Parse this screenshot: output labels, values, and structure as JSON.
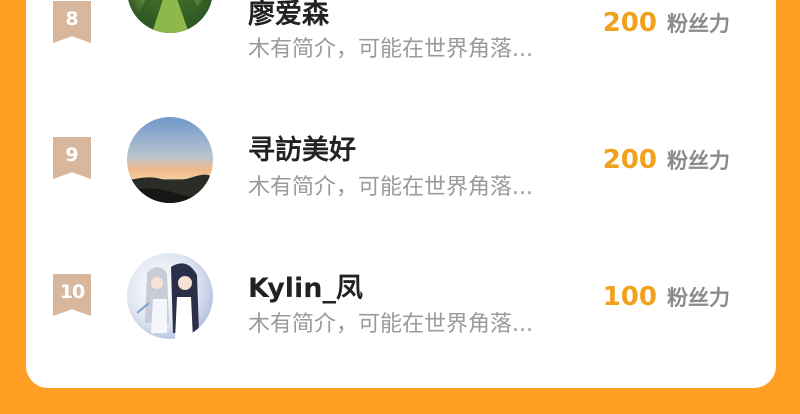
{
  "rows": [
    {
      "rank": "8",
      "name": "廖爱森",
      "intro": "木有简介，可能在世界角落...",
      "fans_count": "200",
      "fans_unit": "粉丝力",
      "avatar": "green-armored-warrior-avatar"
    },
    {
      "rank": "9",
      "name": "寻訪美好",
      "intro": "木有简介，可能在世界角落...",
      "fans_count": "200",
      "fans_unit": "粉丝力",
      "avatar": "sunset-landscape-avatar"
    },
    {
      "rank": "10",
      "name": "Kylin_凤",
      "intro": "木有简介，可能在世界角落...",
      "fans_count": "100",
      "fans_unit": "粉丝力",
      "avatar": "anime-characters-avatar"
    }
  ],
  "colors": {
    "background": "#ff9f24",
    "card": "#ffffff",
    "rank_badge": "#d8b79c",
    "fans_number": "#f2a11c",
    "fans_unit": "#8b8b8b",
    "name": "#222222",
    "intro": "#9a9a9a"
  }
}
